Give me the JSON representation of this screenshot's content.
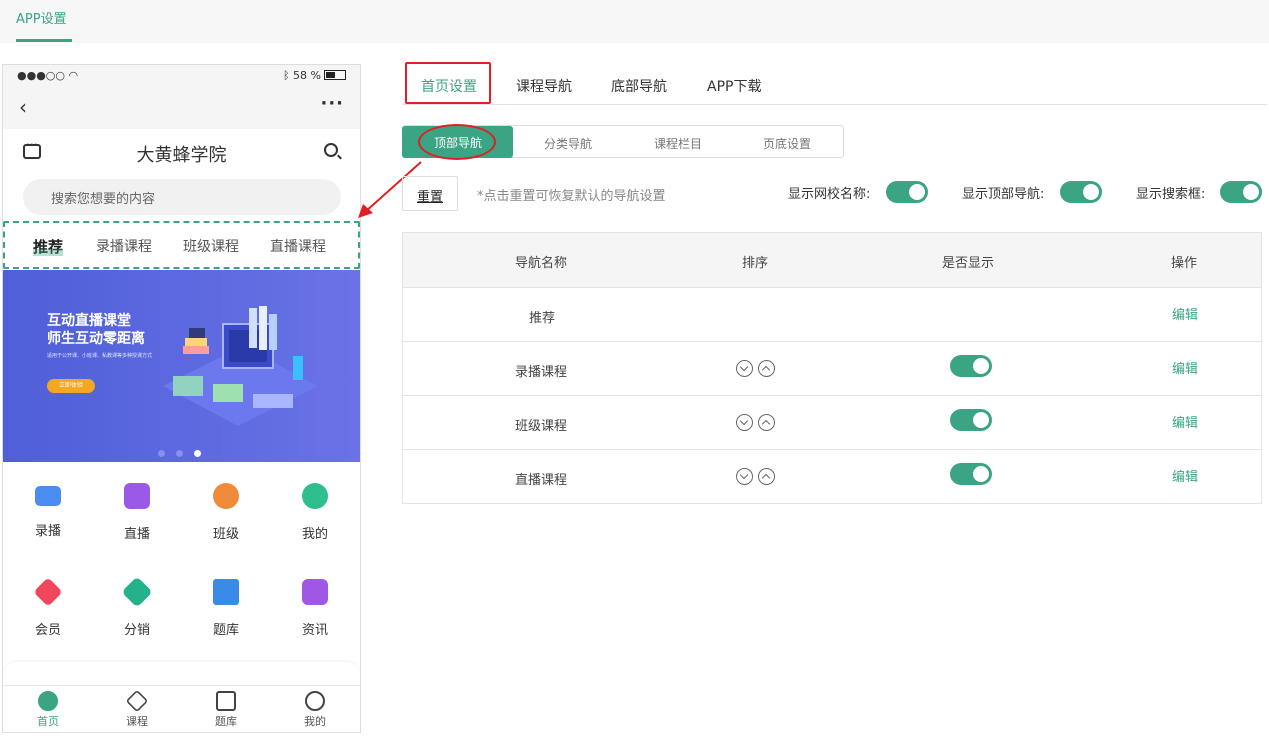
{
  "top": {
    "tab": "APP设置"
  },
  "phone": {
    "status": {
      "signal": "●●●○○",
      "battery": "58 %"
    },
    "school_name": "大黄蜂学院",
    "search_placeholder": "搜索您想要的内容",
    "categories": [
      "推荐",
      "录播课程",
      "班级课程",
      "直播课程"
    ],
    "banner": {
      "title1": "互动直播课堂",
      "title2": "师生互动零距离",
      "subtitle": "适用于公开课、小班课、私教课等多种授课方式",
      "button": "立即体验"
    },
    "grid": [
      {
        "label": "录播",
        "icon": "video-camera-icon",
        "color": "#4a8cf0"
      },
      {
        "label": "直播",
        "icon": "tv-play-icon",
        "color": "#9b59e8"
      },
      {
        "label": "班级",
        "icon": "planet-icon",
        "color": "#f08a3a"
      },
      {
        "label": "我的",
        "icon": "bear-face-icon",
        "color": "#2fbf8f"
      },
      {
        "label": "会员",
        "icon": "diamond-icon",
        "color": "#f0485a"
      },
      {
        "label": "分销",
        "icon": "tag-icon",
        "color": "#24b28c"
      },
      {
        "label": "题库",
        "icon": "book-icon",
        "color": "#3a8ae8"
      },
      {
        "label": "资讯",
        "icon": "news-icon",
        "color": "#a057e6"
      }
    ],
    "tabbar": [
      "首页",
      "课程",
      "题库",
      "我的"
    ]
  },
  "tabs": [
    "首页设置",
    "课程导航",
    "底部导航",
    "APP下载"
  ],
  "subtabs": [
    "顶部导航",
    "分类导航",
    "课程栏目",
    "页底设置"
  ],
  "toolbar": {
    "reset": "重置",
    "hint": "*点击重置可恢复默认的导航设置",
    "toggles": [
      "显示网校名称:",
      "显示顶部导航:",
      "显示搜索框:"
    ]
  },
  "table": {
    "headers": [
      "导航名称",
      "排序",
      "是否显示",
      "操作"
    ],
    "rows": [
      {
        "name": "推荐",
        "sortable": false,
        "shown": null,
        "action": "编辑"
      },
      {
        "name": "录播课程",
        "sortable": true,
        "shown": true,
        "action": "编辑"
      },
      {
        "name": "班级课程",
        "sortable": true,
        "shown": true,
        "action": "编辑"
      },
      {
        "name": "直播课程",
        "sortable": true,
        "shown": true,
        "action": "编辑"
      }
    ]
  },
  "colors": {
    "accent": "#3aa485",
    "highlight": "#e02020"
  }
}
